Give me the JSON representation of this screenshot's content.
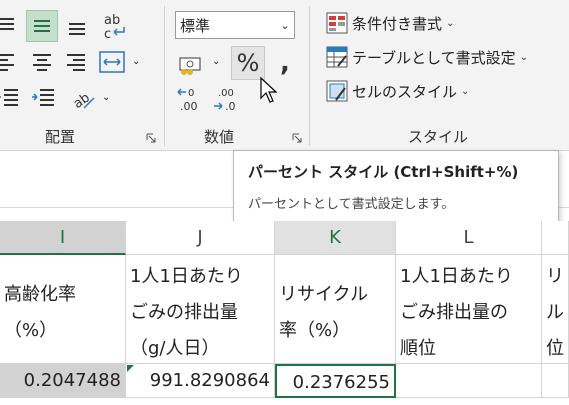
{
  "ribbon": {
    "alignment_group_label": "配置",
    "number_group_label": "数値",
    "styles_group_label": "スタイル",
    "number_format_value": "標準",
    "percent_symbol": "%",
    "comma_symbol": "❟",
    "conditional_formatting_label": "条件付き書式",
    "format_as_table_label": "テーブルとして書式設定",
    "cell_styles_label": "セルのスタイル",
    "wrap_icon_text": "ab"
  },
  "tooltip": {
    "title": "パーセント スタイル (Ctrl+Shift+%)",
    "description": "パーセントとして書式設定します。"
  },
  "sheet": {
    "columns": [
      "I",
      "J",
      "K",
      "L"
    ],
    "headers": {
      "I": [
        "高齢化率",
        "（%）"
      ],
      "J": [
        "1人1日あたり",
        "ごみの排出量",
        "（g/人日）"
      ],
      "K": [
        "リサイクル",
        "率（%）"
      ],
      "L": [
        "1人1日あたり",
        "ごみ排出量の",
        "順位"
      ],
      "M": [
        "リ",
        "ル",
        "位"
      ]
    },
    "values": {
      "I": "0.2047488",
      "J": "991.8290864",
      "K": "0.2376255"
    }
  },
  "colors": {
    "accent": "#217346",
    "selection": "#d2d2d2"
  }
}
